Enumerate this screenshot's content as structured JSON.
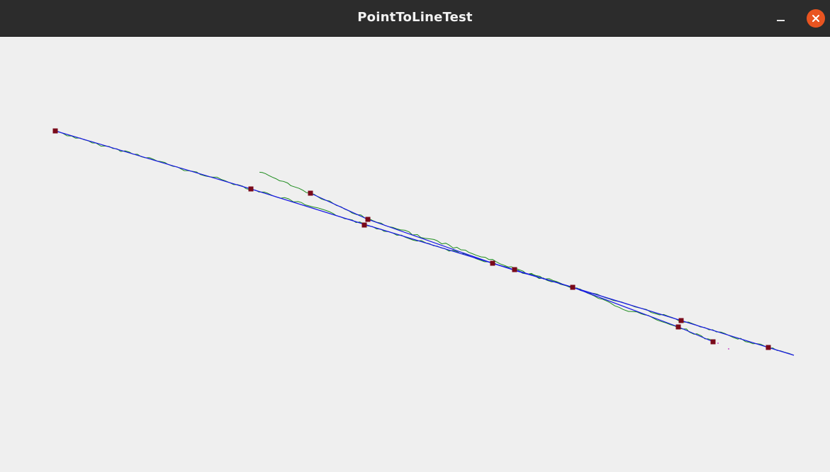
{
  "window": {
    "title": "PointToLineTest"
  },
  "icons": {
    "minimize": "minimize-icon",
    "close": "close-icon"
  },
  "colors": {
    "titlebar": "#2c2c2c",
    "close_button": "#e95420",
    "canvas_background": "#efefef",
    "raw_path": "#1e8c1e",
    "fitted_line": "#1a1ae6",
    "marker": "#7a0a1a",
    "stray_point": "#c020c0"
  }
}
